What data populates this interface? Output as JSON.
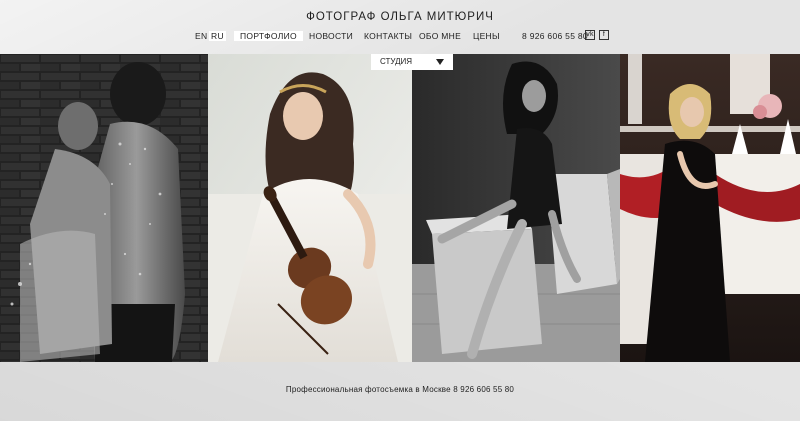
{
  "header": {
    "title": "ФОТОГРАФ ОЛЬГА МИТЮРИЧ",
    "languages": [
      "EN",
      "RU"
    ],
    "nav": [
      "ПОРТФОЛИО",
      "НОВОСТИ",
      "КОНТАКТЫ",
      "ОБО МНЕ",
      "ЦЕНЫ"
    ],
    "phone": "8 926 606 55 80",
    "social": [
      {
        "icon": "vk-icon",
        "glyph": "vk"
      },
      {
        "icon": "facebook-icon",
        "glyph": "f"
      }
    ]
  },
  "portfolio": {
    "category": "СТУДИЯ"
  },
  "gallery": [
    {
      "name": "photo-couple-bw",
      "tone": "bw"
    },
    {
      "name": "photo-violinist",
      "tone": "light"
    },
    {
      "name": "photo-woman-cube-bw",
      "tone": "bw"
    },
    {
      "name": "photo-woman-banquet",
      "tone": "dark-red"
    }
  ],
  "footer": {
    "text": "Профессиональная фотосъемка в Москве  8 926 606 55 80"
  },
  "colors": {
    "background": "#e4e4e4",
    "text": "#222222",
    "active_bg": "#ffffff",
    "accent_red": "#a01c22"
  }
}
